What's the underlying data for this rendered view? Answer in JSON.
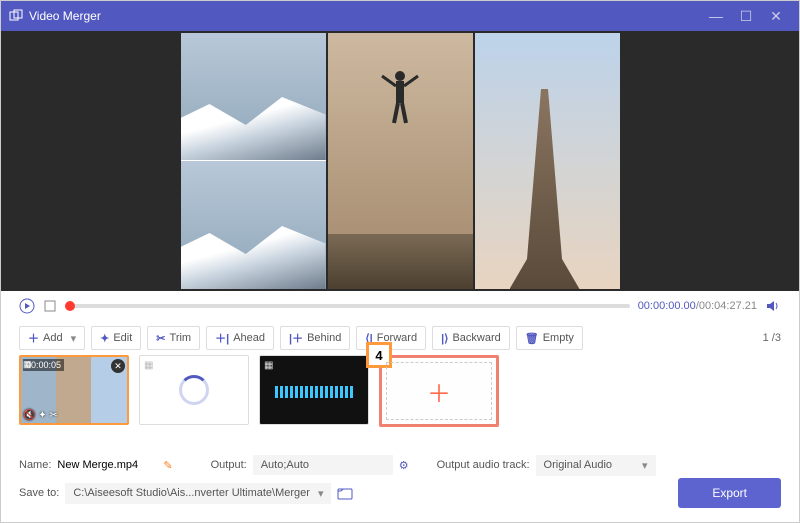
{
  "title": "Video Merger",
  "time_current": "00:00:00.00",
  "time_total": "00:04:27.21",
  "toolbar": {
    "add": "Add",
    "edit": "Edit",
    "trim": "Trim",
    "ahead": "Ahead",
    "behind": "Behind",
    "forward": "Forward",
    "backward": "Backward",
    "empty": "Empty"
  },
  "page_index": "1",
  "page_total": "3",
  "clip_tc": "00:00:05",
  "callout_number": "4",
  "settings": {
    "name_label": "Name:",
    "name_value": "New Merge.mp4",
    "output_label": "Output:",
    "output_value": "Auto;Auto",
    "audio_label": "Output audio track:",
    "audio_value": "Original Audio",
    "save_label": "Save to:",
    "save_path": "C:\\Aiseesoft Studio\\Ais...nverter Ultimate\\Merger"
  },
  "export_label": "Export"
}
